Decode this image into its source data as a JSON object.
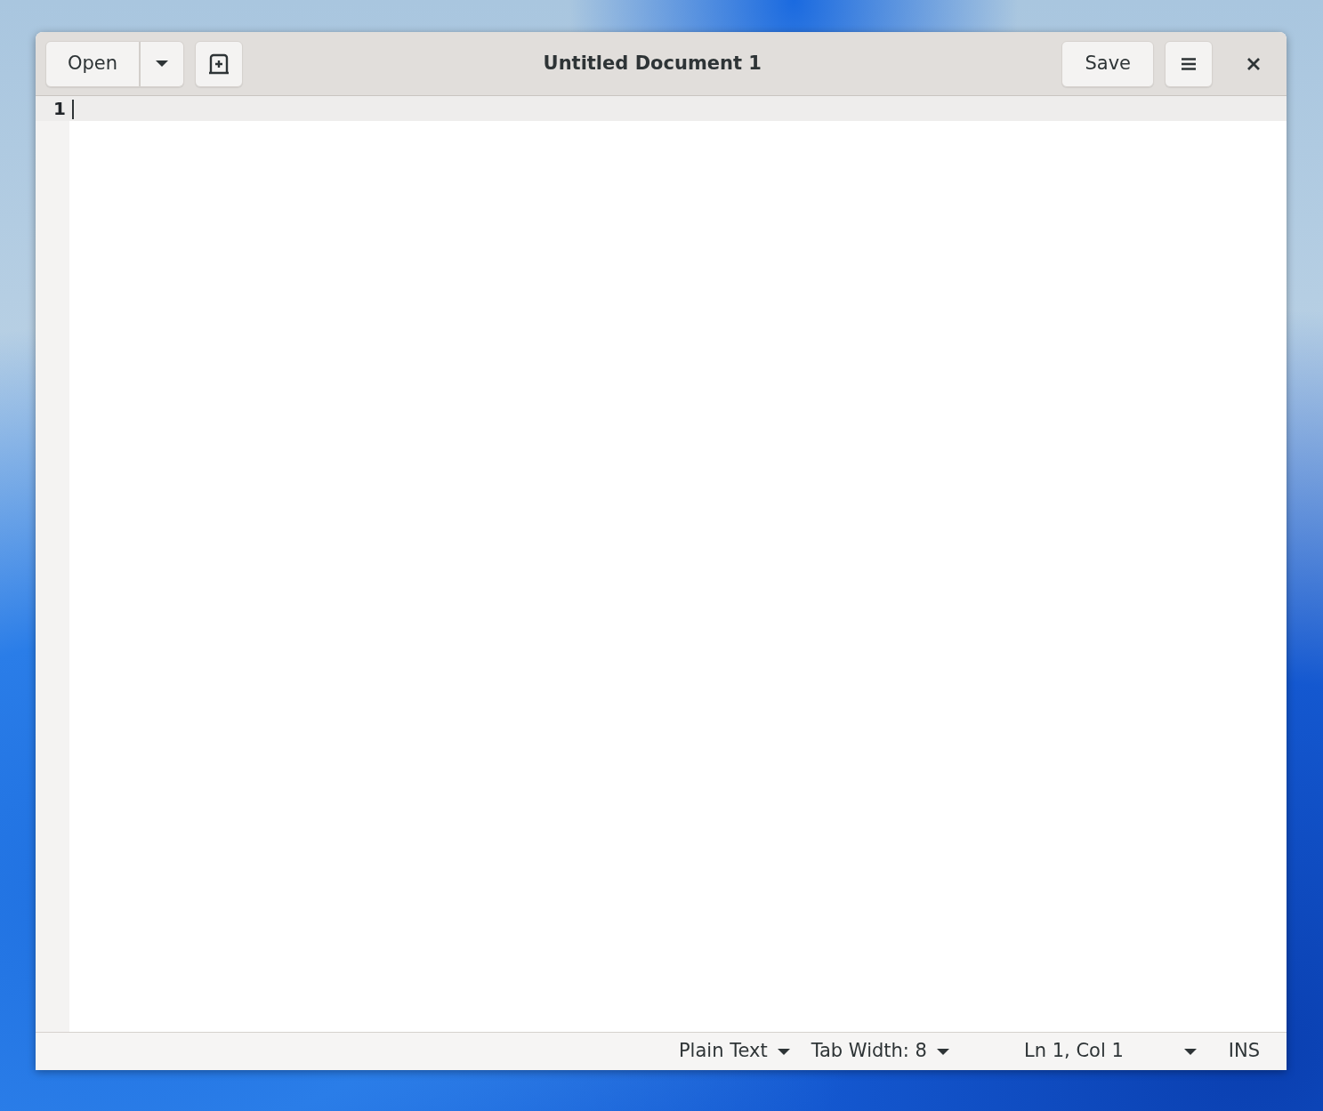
{
  "window": {
    "title": "Untitled Document 1"
  },
  "header": {
    "open_button": "Open",
    "save_button": "Save"
  },
  "editor": {
    "line_numbers": [
      "1"
    ]
  },
  "status_bar": [
    {
      "kind": "dropdown",
      "label": "Plain Text"
    },
    {
      "kind": "dropdown",
      "label": "Tab Width: 8"
    },
    {
      "kind": "dropdown-wide",
      "label": "Ln 1, Col 1"
    },
    {
      "kind": "text",
      "label": "INS"
    }
  ]
}
